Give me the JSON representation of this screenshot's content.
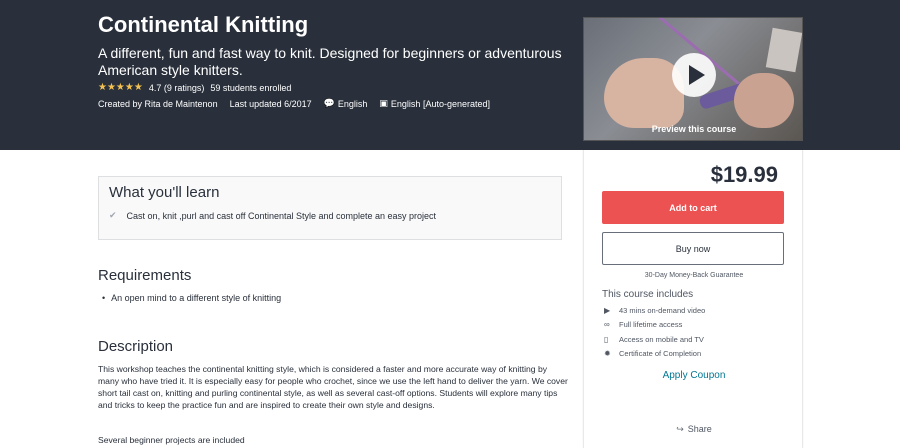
{
  "course": {
    "title": "Continental Knitting",
    "subtitle": "A different, fun and fast way to knit. Designed for beginners or adventurous American style knitters.",
    "stars": "★★★★★",
    "rating": "4.7 (9 ratings)",
    "enrolled": "59 students enrolled",
    "created_by": "Created by Rita de Maintenon",
    "last_updated": "Last updated 6/2017",
    "language": "English",
    "captions": "English [Auto-generated]"
  },
  "preview": {
    "label": "Preview this course"
  },
  "sidebar": {
    "price": "$19.99",
    "add_to_cart": "Add to cart",
    "buy_now": "Buy now",
    "guarantee": "30-Day Money-Back Guarantee",
    "includes_title": "This course includes",
    "includes": [
      {
        "icon": "video-icon",
        "label": "43 mins on-demand video"
      },
      {
        "icon": "infinity-icon",
        "label": "Full lifetime access"
      },
      {
        "icon": "mobile-icon",
        "label": "Access on mobile and TV"
      },
      {
        "icon": "certificate-icon",
        "label": "Certificate of Completion"
      }
    ],
    "apply_coupon": "Apply Coupon",
    "share": "Share"
  },
  "learn": {
    "title": "What you'll learn",
    "items": [
      "Cast on, knit ,purl and cast off Continental Style and complete an easy project"
    ]
  },
  "requirements": {
    "title": "Requirements",
    "items": [
      "An open mind to a different style of knitting"
    ]
  },
  "description": {
    "title": "Description",
    "paragraph1": "This workshop teaches the continental knitting style, which is considered a faster and more accurate way of knitting by many who have tried it. It is especially easy for people who crochet, since we use the left hand to deliver the yarn. We cover short tail cast on, knitting and purling continental style, as well as several cast-off options. Students will explore many tips and tricks to keep the practice fun and are inspired to create their own style and designs.",
    "paragraph2": "Several beginner projects are included"
  },
  "colors": {
    "hero_bg": "#29303b",
    "cart_button": "#ec5252",
    "link": "#007791",
    "star": "#f4c150"
  }
}
